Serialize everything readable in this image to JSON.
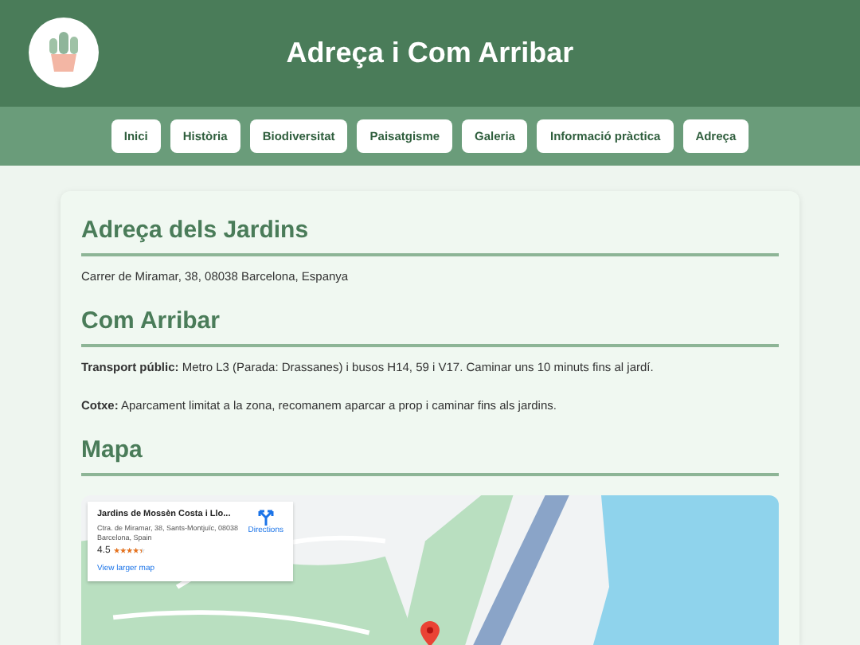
{
  "header": {
    "title": "Adreça i Com Arribar"
  },
  "nav": [
    {
      "label": "Inici",
      "selected": false
    },
    {
      "label": "Història",
      "selected": false
    },
    {
      "label": "Biodiversitat",
      "selected": false
    },
    {
      "label": "Paisatgisme",
      "selected": false
    },
    {
      "label": "Galeria",
      "selected": false
    },
    {
      "label": "Informació pràctica",
      "selected": false
    },
    {
      "label": "Adreça",
      "selected": false
    }
  ],
  "sections": [
    {
      "heading": "Adreça dels Jardins",
      "paragraphs": [
        "Carrer de Miramar, 38, 08038 Barcelona, Espanya"
      ]
    },
    {
      "heading": "Com Arribar",
      "paragraphs": [
        "**Transport públic:** Metro L3 (Parada: Drassanes) i busos H14, 59 i V17. Caminar uns 10 minuts fins al jardí.",
        "**Cotxe:** Aparcament limitat a la zona, recomanem aparcar a prop i caminar fins als jardins."
      ]
    },
    {
      "heading": "Mapa"
    }
  ],
  "map": {
    "place_card": {
      "name": "Jardins de Mossèn Costa i Llo...",
      "address": "Ctra. de Miramar, 38, Sants-Montjuïc, 08038 Barcelona, Spain",
      "rating": "4.5",
      "stars": 4.5,
      "directions": "Directions",
      "larger_map": "View larger map"
    }
  }
}
